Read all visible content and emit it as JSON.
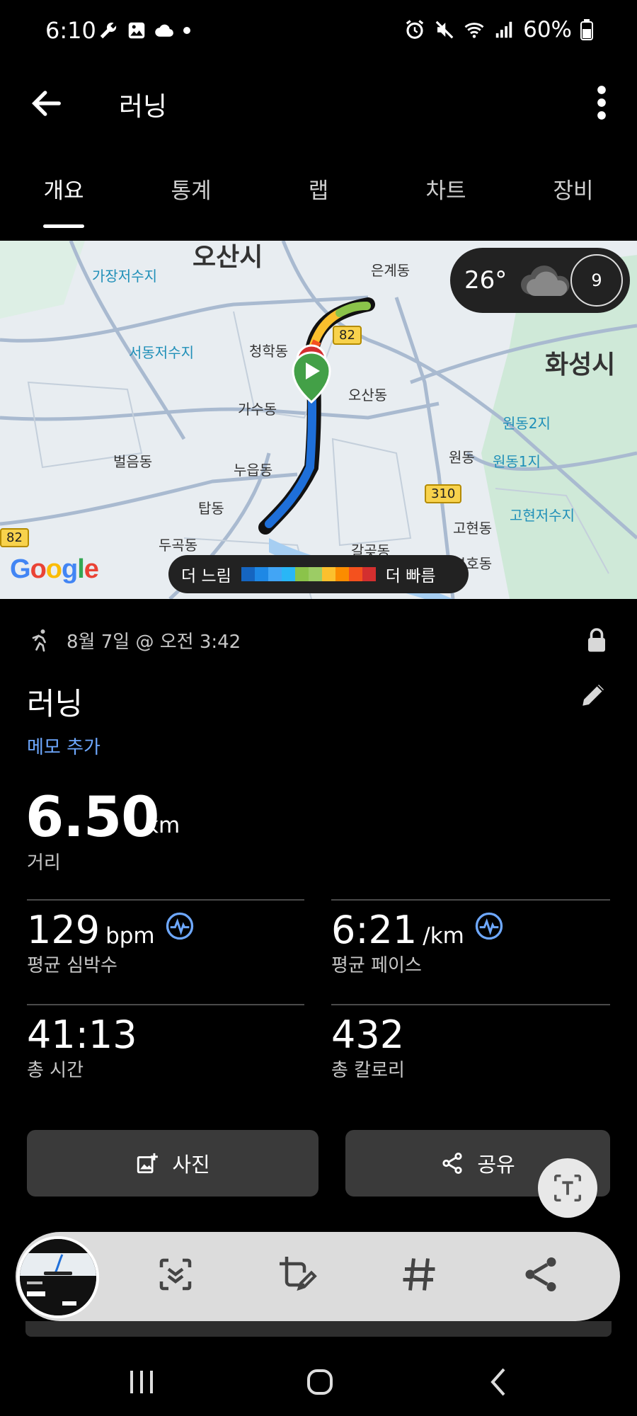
{
  "status_bar": {
    "time": "6:10",
    "battery": "60%",
    "left_icons": [
      "wrench-icon",
      "gallery-icon",
      "cloud-icon",
      "dot-icon"
    ],
    "right_icons": [
      "alarm-icon",
      "mute-icon",
      "wifi-icon",
      "signal-icon",
      "battery-icon"
    ]
  },
  "app_bar": {
    "title": "러닝"
  },
  "tabs": [
    {
      "label": "개요",
      "active": true
    },
    {
      "label": "통계",
      "active": false
    },
    {
      "label": "랩",
      "active": false
    },
    {
      "label": "차트",
      "active": false
    },
    {
      "label": "장비",
      "active": false
    }
  ],
  "map": {
    "labels": {
      "osan_si": "오산시",
      "hwaseong_si": "화성시",
      "gajang_reservoir": "가장저수지",
      "seodong_reservoir": "서동저수지",
      "eungye_dong": "은계동",
      "cheonghak_dong": "청학동",
      "gasu_dong": "가수동",
      "osan_dong": "오산동",
      "wondong_2ji": "원동2지",
      "wondong": "원동",
      "wondong_1ji": "원동1지",
      "beoleum_dong": "벌음동",
      "nueup_dong": "누읍동",
      "tap_dong": "탑동",
      "dugok_dong": "두곡동",
      "gohyeon_dong": "고현동",
      "gohyeon_reservoir": "고현저수지",
      "galgot_dong": "갈곶동",
      "buho_dong": "부호동"
    },
    "road_badges": {
      "r82_top": "82",
      "r310": "310",
      "r82_left": "82"
    },
    "weather": {
      "temp": "26°",
      "uv": "9"
    },
    "google_logo": "Google",
    "legend": {
      "slower": "더 느림",
      "faster": "더 빠름",
      "colors": [
        "#1565c0",
        "#1e88e5",
        "#42a5f5",
        "#29b6f6",
        "#8bc34a",
        "#9ccc65",
        "#fbc02d",
        "#fb8c00",
        "#f4511e",
        "#d32f2f"
      ]
    }
  },
  "activity": {
    "datetime": "8월 7일 @ 오전 3:42",
    "title": "러닝",
    "memo_link": "메모 추가",
    "distance": {
      "value": "6.50",
      "unit": "km",
      "label": "거리"
    },
    "stats": [
      {
        "value": "129",
        "unit": "bpm",
        "label": "평균 심박수"
      },
      {
        "value": "6:21",
        "unit": "/km",
        "label": "평균 페이스"
      },
      {
        "value": "41:13",
        "unit": "",
        "label": "총 시간"
      },
      {
        "value": "432",
        "unit": "",
        "label": "총 칼로리"
      }
    ]
  },
  "buttons": {
    "photo": "사진",
    "share": "공유"
  },
  "colors": {
    "accent_blue": "#6ea8ff",
    "button_bg": "#3a3a3a",
    "route_blue": "#1e6fd9"
  }
}
